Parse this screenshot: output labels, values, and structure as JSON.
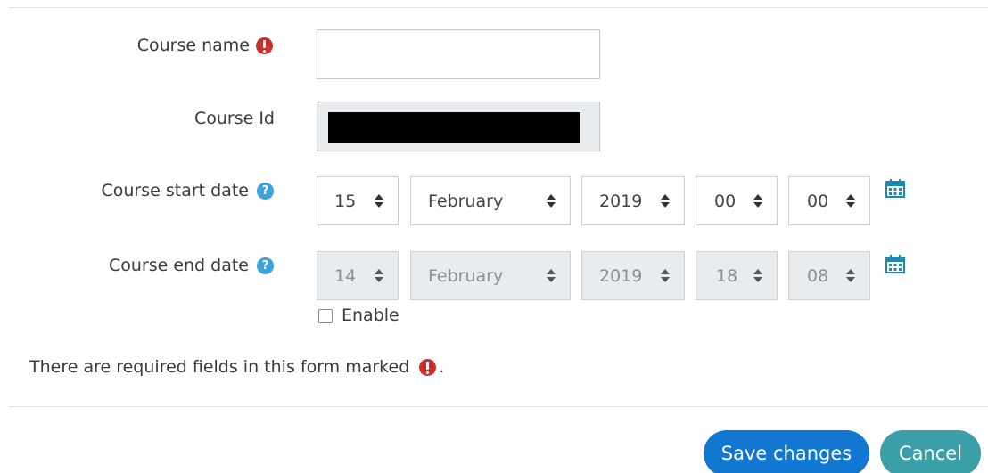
{
  "form": {
    "course_name": {
      "label": "Course name",
      "value": ""
    },
    "course_id": {
      "label": "Course Id"
    },
    "start_date": {
      "label": "Course start date",
      "day": "15",
      "month": "February",
      "year": "2019",
      "hour": "00",
      "minute": "00"
    },
    "end_date": {
      "label": "Course end date",
      "day": "14",
      "month": "February",
      "year": "2019",
      "hour": "18",
      "minute": "08",
      "enable_label": "Enable"
    },
    "required_note": "There are required fields in this form marked",
    "required_note_suffix": "."
  },
  "buttons": {
    "save": "Save changes",
    "cancel": "Cancel"
  },
  "colors": {
    "required": "#c9302c",
    "help": "#3ca2da",
    "primary": "#1177d1",
    "secondary": "#3a9fa8"
  },
  "icons": {
    "required": "exclamation-circle-icon",
    "help": "question-circle-icon",
    "calendar": "calendar-icon"
  }
}
